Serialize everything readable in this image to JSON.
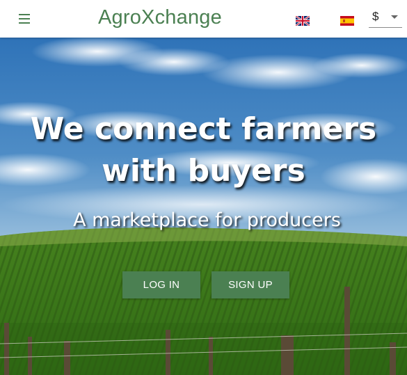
{
  "header": {
    "brand": "AgroXchange",
    "menu_icon": "menu-icon",
    "languages": [
      {
        "code": "en",
        "icon": "uk-flag-icon"
      },
      {
        "code": "es",
        "icon": "spain-flag-icon"
      }
    ],
    "currency": {
      "selected": "$"
    }
  },
  "hero": {
    "headline_line1": "We connect farmers",
    "headline_line2": "with buyers",
    "subheadline": "A marketplace for producers",
    "login_label": "LOG IN",
    "signup_label": "SIGN UP"
  },
  "colors": {
    "brand": "#4b8052",
    "button_bg": "#4b8052",
    "button_text": "#ffffff",
    "hero_text": "#ffffff"
  }
}
